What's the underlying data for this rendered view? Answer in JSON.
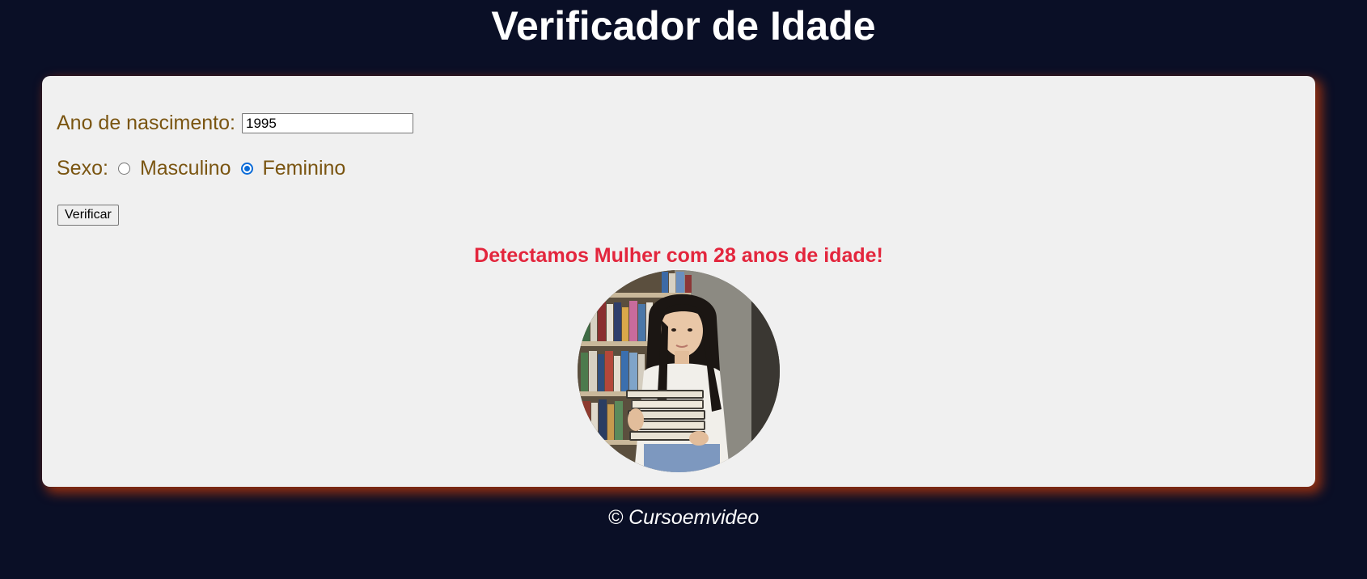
{
  "header": {
    "title": "Verificador de Idade"
  },
  "form": {
    "year_label": "Ano de nascimento:",
    "year_value": "1995",
    "sex_label": "Sexo:",
    "sex_options": [
      {
        "label": "Masculino",
        "checked": false
      },
      {
        "label": "Feminino",
        "checked": true
      }
    ],
    "verify_label": "Verificar"
  },
  "result": {
    "message": "Detectamos Mulher com 28 anos de idade!",
    "image_alt": "woman-holding-books-photo"
  },
  "footer": {
    "text": "© Cursoemvideo"
  },
  "colors": {
    "background": "#0a0f26",
    "panel": "#f0f0f0",
    "label": "#7a5511",
    "result": "#e3263d",
    "glow": "#ff4800"
  }
}
